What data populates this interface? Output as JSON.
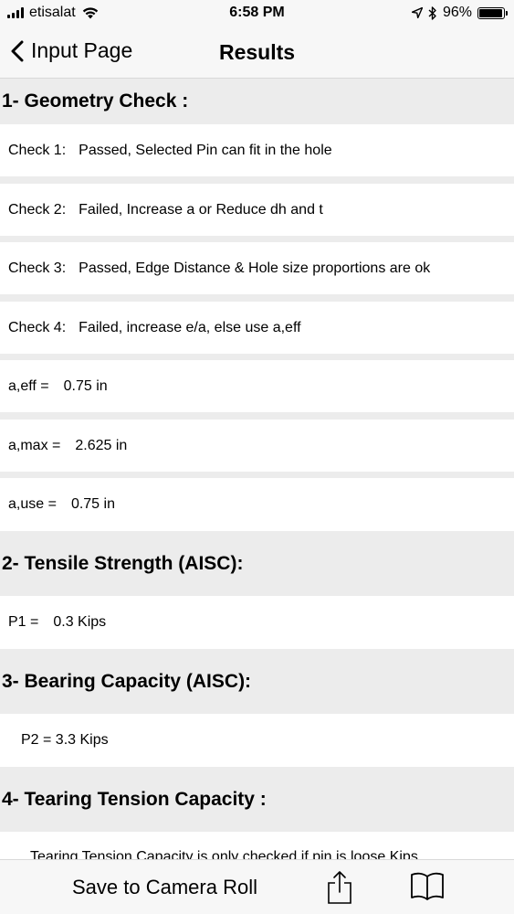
{
  "status_bar": {
    "carrier": "etisalat",
    "time": "6:58 PM",
    "battery": "96%",
    "battery_level": 0.96,
    "icons": [
      "signal-bars-icon",
      "wifi-icon",
      "location-arrow-icon",
      "bluetooth-icon",
      "battery-icon"
    ]
  },
  "nav": {
    "back_label": "Input Page",
    "title": "Results"
  },
  "sections": {
    "geometry": {
      "title": "1- Geometry Check :",
      "check1": {
        "label": "Check 1:",
        "value": "Passed, Selected Pin can fit in the hole"
      },
      "check2": {
        "label": "Check 2:",
        "value": "Failed, Increase a or Reduce dh and t"
      },
      "check3": {
        "label": "Check 3:",
        "value": "Passed, Edge Distance & Hole size proportions are ok"
      },
      "check4": {
        "label": "Check 4:",
        "value": "Failed, increase e/a, else use a,eff"
      },
      "a_eff": {
        "label": "a,eff =",
        "value": "0.75 in"
      },
      "a_max": {
        "label": "a,max =",
        "value": "2.625 in"
      },
      "a_use": {
        "label": "a,use =",
        "value": "0.75 in"
      }
    },
    "tensile": {
      "title": "2- Tensile Strength (AISC):",
      "p1": {
        "label": "P1 =",
        "value": "0.3 Kips"
      }
    },
    "bearing": {
      "title": "3- Bearing Capacity (AISC):",
      "p2": {
        "text": "P2 = 3.3 Kips"
      }
    },
    "tearing": {
      "title": "4- Tearing Tension Capacity :",
      "note": "Tearing Tension Capacity is only checked if pin is loose Kips"
    }
  },
  "toolbar": {
    "save_label": "Save to Camera Roll",
    "icons": [
      "share-icon",
      "book-icon"
    ]
  }
}
